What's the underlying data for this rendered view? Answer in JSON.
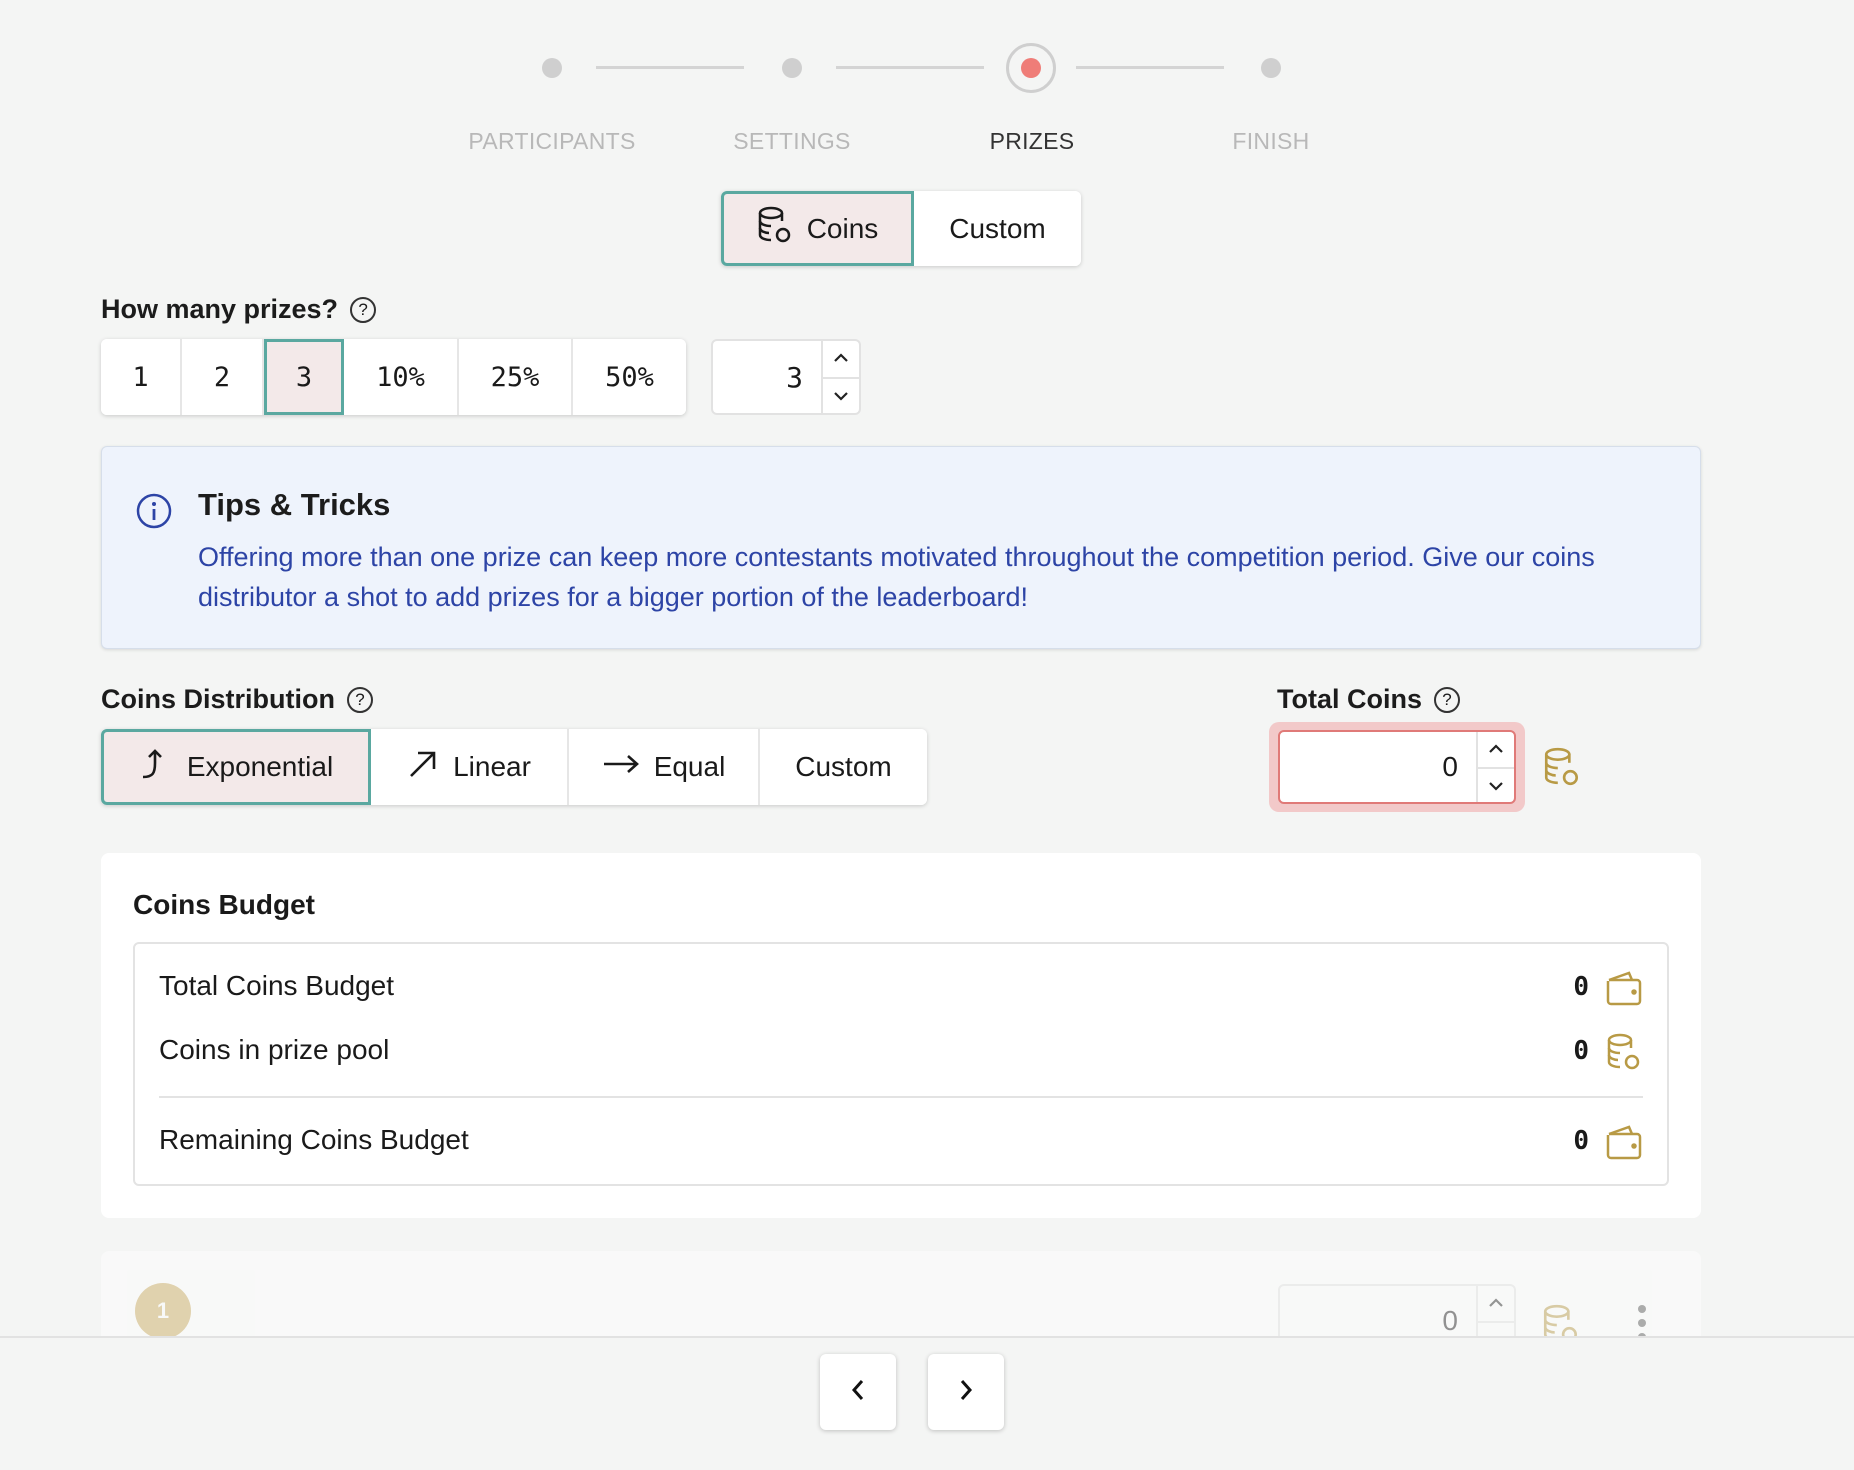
{
  "stepper": {
    "steps": [
      "PARTICIPANTS",
      "SETTINGS",
      "PRIZES",
      "FINISH"
    ],
    "active": "PRIZES"
  },
  "prize_type": {
    "options": [
      "Coins",
      "Custom"
    ],
    "selected": "Coins"
  },
  "prizes_count": {
    "label": "How many prizes?",
    "options": [
      "1",
      "2",
      "3",
      "10%",
      "25%",
      "50%"
    ],
    "selected": "3",
    "value": "3"
  },
  "tips": {
    "title": "Tips & Tricks",
    "body": "Offering more than one prize can keep more contestants motivated throughout the competition period. Give our coins distributor a shot to add prizes for a bigger portion of the leaderboard!"
  },
  "distribution": {
    "label": "Coins Distribution",
    "options": [
      "Exponential",
      "Linear",
      "Equal",
      "Custom"
    ],
    "selected": "Exponential"
  },
  "total_coins": {
    "label": "Total Coins",
    "value": "0"
  },
  "budget": {
    "title": "Coins Budget",
    "rows": [
      {
        "label": "Total Coins Budget",
        "value": "0",
        "icon": "wallet-icon"
      },
      {
        "label": "Coins in prize pool",
        "value": "0",
        "icon": "coins-icon"
      },
      {
        "label": "Remaining Coins Budget",
        "value": "0",
        "icon": "wallet-icon"
      }
    ]
  },
  "prize_row": {
    "rank": "1",
    "value": "0"
  },
  "colors": {
    "accent": "#5aa8a0",
    "selected_bg": "#f3e9e9",
    "active_step": "#ef7d78",
    "tips_text": "#2d44a6",
    "coin_gold": "#b89a45",
    "error_border": "#e07a78"
  }
}
